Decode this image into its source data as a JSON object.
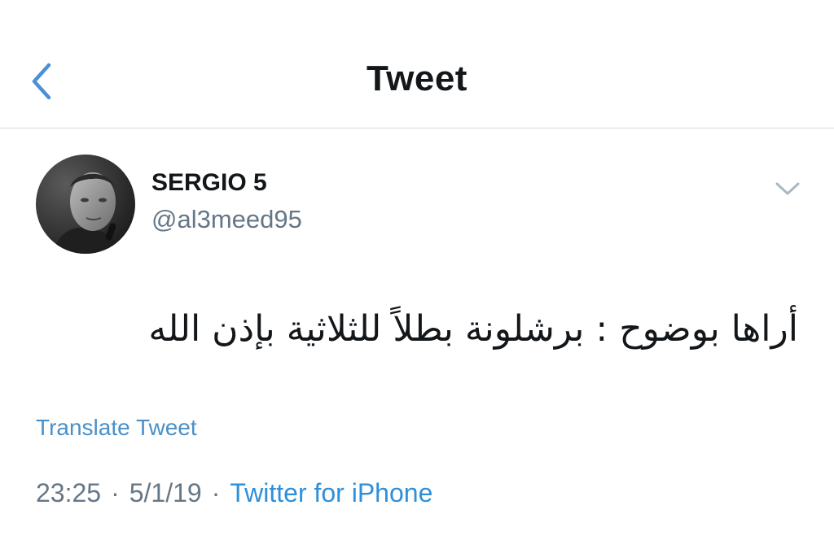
{
  "nav": {
    "title": "Tweet",
    "back_icon": "chevron-left-icon"
  },
  "tweet": {
    "display_name": "SERGIO 5",
    "username": "@al3meed95",
    "text": "أراها بوضوح : برشلونة بطلاً للثلاثية بإذن الله",
    "translate_label": "Translate Tweet",
    "time": "23:25",
    "separator": "·",
    "date": "5/1/19",
    "source": "Twitter for iPhone",
    "caret_icon": "chevron-down-icon",
    "avatar_icon": "profile-photo"
  },
  "colors": {
    "accent": "#4a90c8",
    "link": "#2f8fd8",
    "text_primary": "#14171a",
    "text_secondary": "#657786",
    "divider": "#d6d9db"
  }
}
